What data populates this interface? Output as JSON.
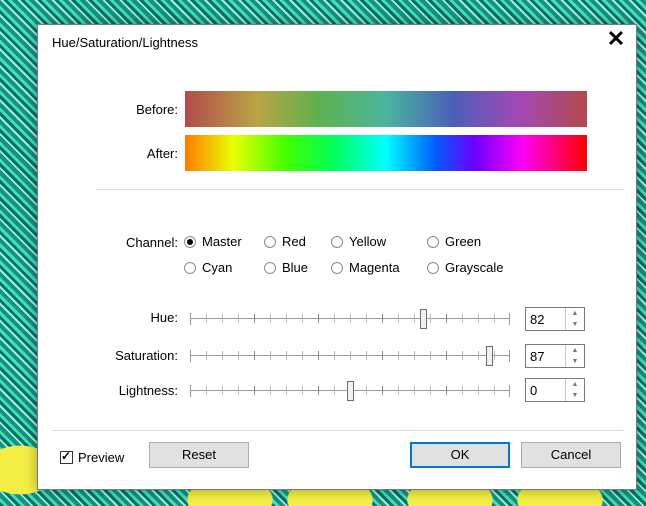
{
  "dialog": {
    "title": "Hue/Saturation/Lightness",
    "close_glyph": "✕"
  },
  "preview_bars": {
    "before_label": "Before:",
    "after_label": "After:"
  },
  "channel": {
    "label": "Channel:",
    "selected": "Master",
    "options": [
      "Master",
      "Red",
      "Yellow",
      "Green",
      "Cyan",
      "Blue",
      "Magenta",
      "Grayscale"
    ]
  },
  "sliders": [
    {
      "label": "Hue:",
      "value": "82",
      "min": -180,
      "max": 180
    },
    {
      "label": "Saturation:",
      "value": "87",
      "min": -100,
      "max": 100
    },
    {
      "label": "Lightness:",
      "value": "0",
      "min": -100,
      "max": 100
    }
  ],
  "footer": {
    "preview_label": "Preview",
    "preview_checked": true,
    "reset_label": "Reset",
    "ok_label": "OK",
    "cancel_label": "Cancel"
  },
  "colors": {
    "accent": "#0078d7"
  }
}
